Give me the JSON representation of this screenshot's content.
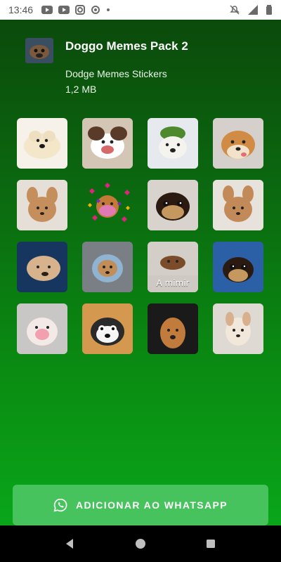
{
  "status_bar": {
    "time": "13:46"
  },
  "header": {
    "title": "Doggo Memes Pack 2",
    "subtitle": "Dodge Memes Stickers",
    "size": "1,2 MB"
  },
  "stickers": [
    {
      "name": "sticker-1",
      "caption": ""
    },
    {
      "name": "sticker-2",
      "caption": ""
    },
    {
      "name": "sticker-3",
      "caption": ""
    },
    {
      "name": "sticker-4",
      "caption": ""
    },
    {
      "name": "sticker-5",
      "caption": ""
    },
    {
      "name": "sticker-6",
      "caption": ""
    },
    {
      "name": "sticker-7",
      "caption": ""
    },
    {
      "name": "sticker-8",
      "caption": ""
    },
    {
      "name": "sticker-9",
      "caption": ""
    },
    {
      "name": "sticker-10",
      "caption": ""
    },
    {
      "name": "sticker-11",
      "caption": "A mimir"
    },
    {
      "name": "sticker-12",
      "caption": ""
    },
    {
      "name": "sticker-13",
      "caption": ""
    },
    {
      "name": "sticker-14",
      "caption": ""
    },
    {
      "name": "sticker-15",
      "caption": ""
    },
    {
      "name": "sticker-16",
      "caption": ""
    }
  ],
  "cta": {
    "label": "ADICIONAR AO WHATSAPP",
    "icon": "whatsapp-icon"
  },
  "navbar": {
    "icons": [
      "back-icon",
      "home-icon",
      "recents-icon"
    ]
  }
}
